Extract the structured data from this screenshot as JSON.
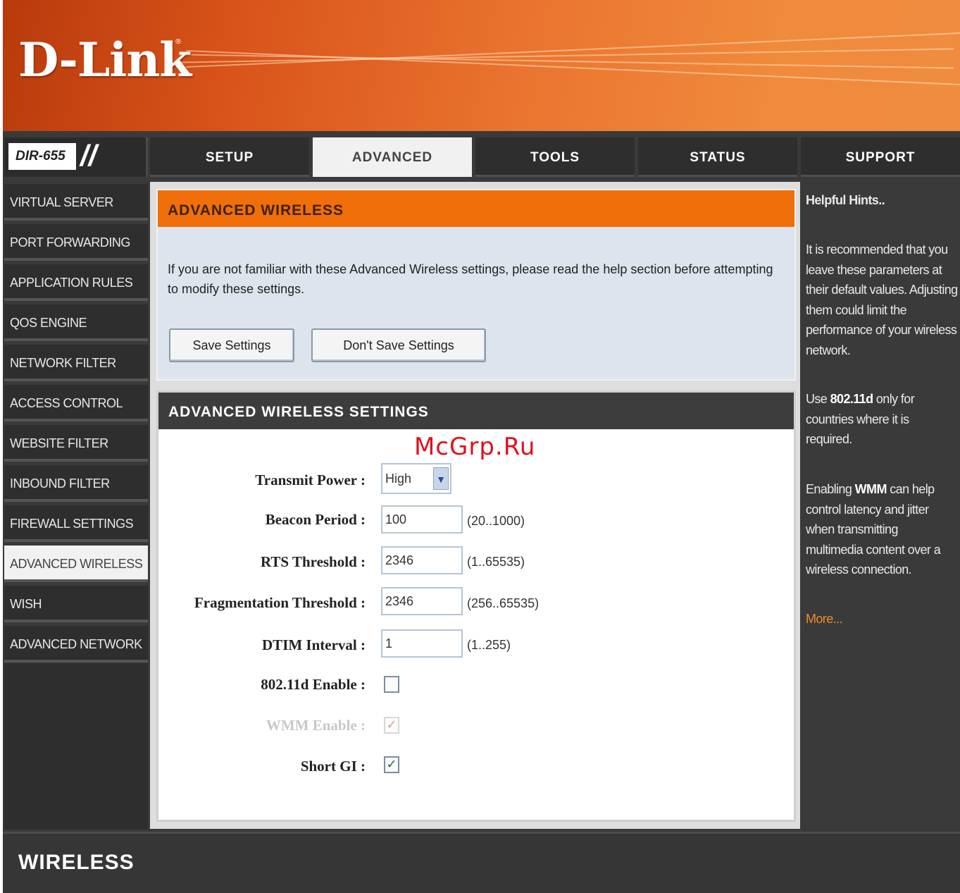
{
  "brand": {
    "logo_text": "D-Link",
    "registered_mark": "®"
  },
  "model": {
    "label": "DIR-655",
    "slashes": "//"
  },
  "top_nav": {
    "tabs": [
      {
        "label": "SETUP",
        "active": false
      },
      {
        "label": "ADVANCED",
        "active": true
      },
      {
        "label": "TOOLS",
        "active": false
      },
      {
        "label": "STATUS",
        "active": false
      },
      {
        "label": "SUPPORT",
        "active": false
      }
    ]
  },
  "sidebar": {
    "items": [
      {
        "label": "Virtual Server",
        "active": false
      },
      {
        "label": "Port Forwarding",
        "active": false
      },
      {
        "label": "Application Rules",
        "active": false
      },
      {
        "label": "QoS Engine",
        "active": false
      },
      {
        "label": "Network Filter",
        "active": false
      },
      {
        "label": "Access Control",
        "active": false
      },
      {
        "label": "Website Filter",
        "active": false
      },
      {
        "label": "Inbound Filter",
        "active": false
      },
      {
        "label": "Firewall Settings",
        "active": false
      },
      {
        "label": "Advanced Wireless",
        "active": true
      },
      {
        "label": "WISH",
        "active": false
      },
      {
        "label": "Advanced Network",
        "active": false
      }
    ]
  },
  "advanced_wireless": {
    "title": "ADVANCED WIRELESS",
    "description": "If you are not familiar with these Advanced Wireless settings, please read the help section before attempting to modify these settings.",
    "save_button": "Save Settings",
    "dont_save_button": "Don't Save Settings"
  },
  "settings": {
    "title": "ADVANCED WIRELESS SETTINGS",
    "transmit_power": {
      "label": "Transmit Power :",
      "value": "High",
      "arrow": "▼"
    },
    "beacon_period": {
      "label": "Beacon Period :",
      "value": "100",
      "range": "(20..1000)"
    },
    "rts_threshold": {
      "label": "RTS Threshold :",
      "value": "2346",
      "range": "(1..65535)"
    },
    "fragmentation_threshold": {
      "label": "Fragmentation Threshold :",
      "value": "2346",
      "range": "(256..65535)"
    },
    "dtim_interval": {
      "label": "DTIM Interval :",
      "value": "1",
      "range": "(1..255)"
    },
    "dot11d_enable": {
      "label": "802.11d Enable :",
      "checked": false,
      "mark": ""
    },
    "wmm_enable": {
      "label": "WMM Enable :",
      "checked": true,
      "disabled": true,
      "mark": "✓"
    },
    "short_gi": {
      "label": "Short GI :",
      "checked": true,
      "mark": "✓"
    }
  },
  "watermark": "McGrp.Ru",
  "hints": {
    "title": "Helpful Hints..",
    "p1": "It is recommended that you leave these parameters at their default values. Adjusting them could limit the performance of your wireless network.",
    "p2_pre": "Use ",
    "p2_bold": "802.11d",
    "p2_post": " only for countries where it is required.",
    "p3_pre": "Enabling ",
    "p3_bold": "WMM",
    "p3_post": " can help control latency and jitter when transmitting multimedia content over a wireless connection.",
    "more": "More..."
  },
  "footer": {
    "label": "WIRELESS"
  },
  "colors": {
    "brand_orange": "#f06f0a",
    "header_orange": "#ea7530",
    "nav_dark": "#2e2e2e",
    "hint_link": "#ef8c2a",
    "watermark_red": "#e0101a"
  }
}
